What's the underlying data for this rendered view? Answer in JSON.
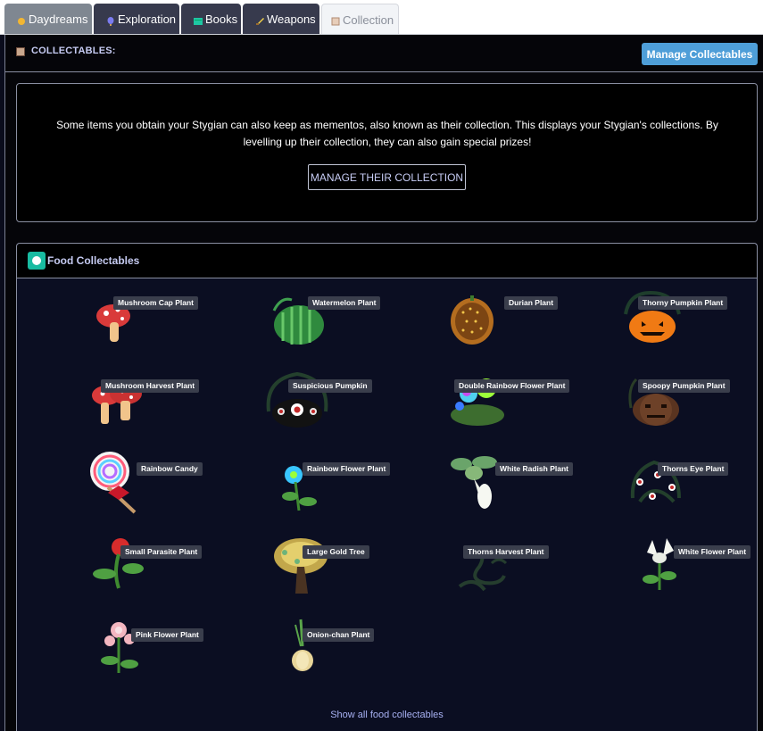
{
  "tabs": [
    {
      "label": "Daydreams",
      "icon": "sun-icon"
    },
    {
      "label": "Exploration",
      "icon": "balloon-icon"
    },
    {
      "label": "Books",
      "icon": "book-icon"
    },
    {
      "label": "Weapons",
      "icon": "sword-icon"
    },
    {
      "label": "Collection",
      "icon": "box-icon",
      "active": true
    }
  ],
  "header": {
    "title": "COLLECTABLES:",
    "manage_label": "Manage Collectables"
  },
  "intro": {
    "text": "Some items you obtain your Stygian can also keep as mementos, also known as their collection. This displays your Stygian's collections. By levelling up their collection, they can also gain special prizes!",
    "button": "MANAGE THEIR COLLECTION"
  },
  "food": {
    "title": "Food Collectables",
    "show_all": "Show all food collectables",
    "items": [
      "Mushroom Cap Plant",
      "Watermelon Plant",
      "Durian Plant",
      "Thorny Pumpkin Plant",
      "Mushroom Harvest Plant",
      "Suspicious Pumpkin",
      "Double Rainbow Flower Plant",
      "Spoopy Pumpkin Plant",
      "Rainbow Candy",
      "Rainbow Flower Plant",
      "White Radish Plant",
      "Thorns Eye Plant",
      "Small Parasite Plant",
      "Large Gold Tree",
      "Thorns Harvest Plant",
      "White Flower Plant",
      "Pink Flower Plant",
      "Onion-chan Plant"
    ]
  },
  "colors": {
    "accent": "#4e9ed8",
    "panel_bg": "#0b0e22",
    "label_bg": "#3a3e4c"
  }
}
